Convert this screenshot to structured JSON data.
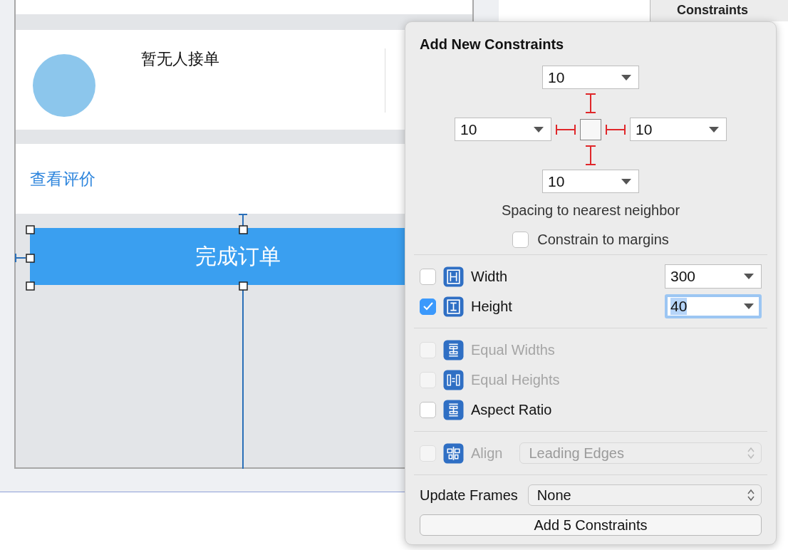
{
  "canvas": {
    "order_status": "暂无人接单",
    "review_link": "查看评价",
    "complete_button": "完成订单"
  },
  "inspector": {
    "header": "Constraints"
  },
  "popover": {
    "title": "Add New Constraints",
    "spacing": [
      {
        "value": "10"
      },
      {
        "value": "10"
      },
      {
        "value": "10"
      },
      {
        "value": "10"
      }
    ],
    "spacing_caption": "Spacing to nearest neighbor",
    "margins": {
      "label": "Constrain to margins",
      "checked": false
    },
    "size": [
      {
        "kind": "width",
        "label": "Width",
        "checked": false,
        "value": "300",
        "focused": false
      },
      {
        "kind": "height",
        "label": "Height",
        "checked": true,
        "value": "40",
        "focused": true
      }
    ],
    "relations": [
      {
        "kind": "equal-widths",
        "label": "Equal Widths",
        "checked": false,
        "disabled": true
      },
      {
        "kind": "equal-heights",
        "label": "Equal Heights",
        "checked": false,
        "disabled": true
      },
      {
        "kind": "aspect-ratio",
        "label": "Aspect Ratio",
        "checked": false,
        "disabled": false
      }
    ],
    "align": {
      "label": "Align",
      "checked": false,
      "disabled": true,
      "value": "Leading Edges"
    },
    "update_frames": {
      "label": "Update Frames",
      "value": "None"
    },
    "add_button": "Add 5 Constraints"
  }
}
